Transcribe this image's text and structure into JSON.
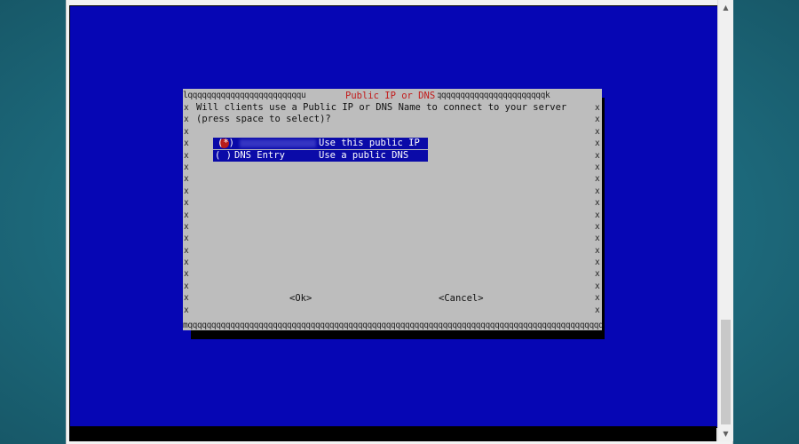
{
  "dialog": {
    "title": "Public IP or DNS",
    "border_top_left": "lqqqqqqqqqqqqqqqqqqqqqqqqu",
    "border_top_right": "tqqqqqqqqqqqqqqqqqqqqqqqqqqk",
    "border_bottom": "mqqqqqqqqqqqqqqqqqqqqqqqqqqqqqqqqqqqqqqqqqqqqqqqqqqqqqqqqqqqqqqqqqqqqqqqqqqqqqqqqqqqqqqqqqqj",
    "side_char": "x",
    "prompt_line_1": "Will clients use a Public IP or DNS Name to connect to your server",
    "prompt_line_2": "(press space to select)?",
    "options": [
      {
        "radio": "(*)",
        "name": "",
        "description": "Use this public IP",
        "selected": true
      },
      {
        "radio": "( )",
        "name": "DNS Entry",
        "description": "Use a public DNS",
        "selected": false
      }
    ],
    "ok_label": "<Ok>",
    "cancel_label": "<Cancel>"
  },
  "colors": {
    "terminal_background": "#0606b4",
    "dialog_background": "#bdbdbd",
    "title_color": "#c21b1b",
    "option_highlight": "#0a0aa8"
  },
  "scrollbar": {
    "up_icon": "triangle-up",
    "down_icon": "triangle-down"
  }
}
